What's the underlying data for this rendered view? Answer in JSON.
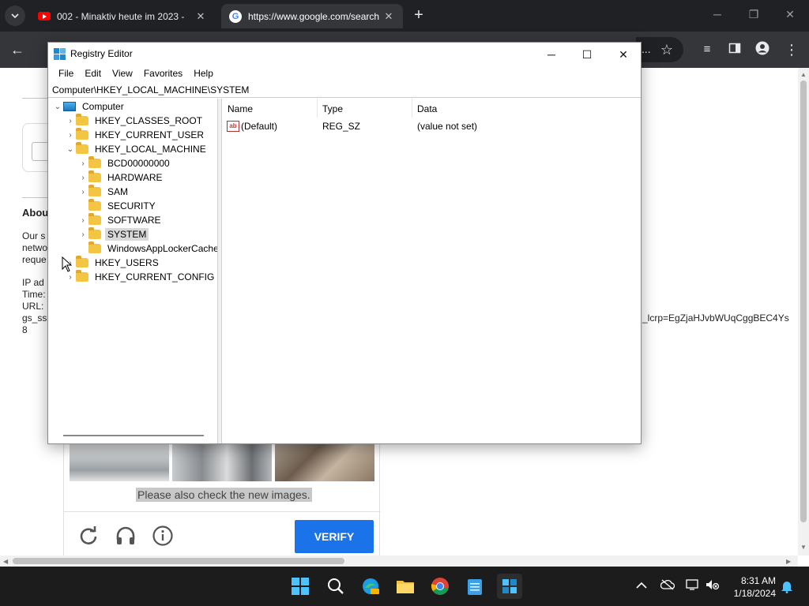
{
  "browser": {
    "tabs": [
      {
        "title": "002 - Minaktiv heute im 2023 -",
        "favicon": "youtube-icon",
        "active": false
      },
      {
        "title": "https://www.google.com/search",
        "favicon": "google-icon",
        "active": true
      }
    ],
    "new_tab_label": "+",
    "omnibox_overflow": "..."
  },
  "webpage": {
    "about_title": "Abou",
    "about_lines": [
      "Our s",
      "netwo",
      "reque",
      "",
      "IP ad",
      "Time:",
      "URL:",
      "gs_ss",
      "8"
    ],
    "url_tail": "_lcrp=EgZjaHJvbWUqCggBEC4Ys",
    "captcha": {
      "note": "Please also check the new images.",
      "verify_label": "VERIFY"
    }
  },
  "regedit": {
    "title": "Registry Editor",
    "menu": [
      "File",
      "Edit",
      "View",
      "Favorites",
      "Help"
    ],
    "address": "Computer\\HKEY_LOCAL_MACHINE\\SYSTEM",
    "tree": {
      "root": "Computer",
      "hkcr": "HKEY_CLASSES_ROOT",
      "hkcu": "HKEY_CURRENT_USER",
      "hklm": "HKEY_LOCAL_MACHINE",
      "hklm_children": [
        "BCD00000000",
        "HARDWARE",
        "SAM",
        "SECURITY",
        "SOFTWARE",
        "SYSTEM",
        "WindowsAppLockerCache"
      ],
      "hku": "HKEY_USERS",
      "hkcc": "HKEY_CURRENT_CONFIG",
      "selected": "SYSTEM"
    },
    "columns": [
      "Name",
      "Type",
      "Data"
    ],
    "values": [
      {
        "name": "(Default)",
        "type": "REG_SZ",
        "data": "(value not set)"
      }
    ]
  },
  "taskbar": {
    "clock_time": "8:31 AM",
    "clock_date": "1/18/2024",
    "accent": "#4cc2ff"
  }
}
